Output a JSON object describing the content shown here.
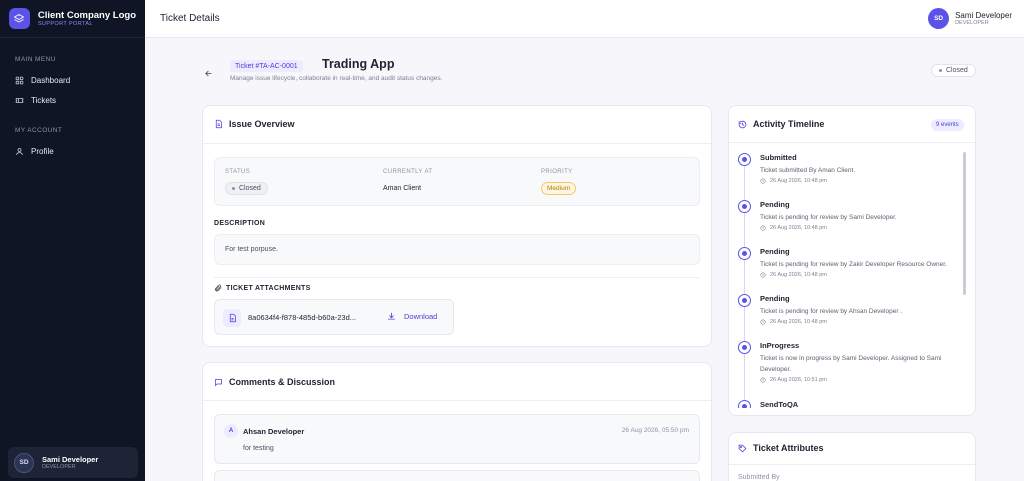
{
  "brand": {
    "title": "Client Company Logo",
    "subtitle": "SUPPORT PORTAL"
  },
  "sidebar": {
    "main_menu_label": "MAIN MENU",
    "main_items": [
      {
        "label": "Dashboard",
        "icon": "grid-icon"
      },
      {
        "label": "Tickets",
        "icon": "ticket-icon"
      }
    ],
    "account_label": "MY ACCOUNT",
    "account_items": [
      {
        "label": "Profile",
        "icon": "user-icon"
      }
    ],
    "user": {
      "initials": "SD",
      "name": "Sami Developer",
      "role": "DEVELOPER"
    }
  },
  "header": {
    "title": "Ticket Details",
    "user": {
      "initials": "SD",
      "name": "Sami Developer",
      "role": "DEVELOPER"
    }
  },
  "ticket": {
    "id": "Ticket #TA-AC-0001",
    "title": "Trading App",
    "subtitle": "Manage issue lifecycle, collaborate in real-time, and audit status changes.",
    "status": "Closed"
  },
  "overview": {
    "title": "Issue Overview",
    "status_label": "STATUS",
    "status_value": "Closed",
    "currently_at_label": "CURRENTLY AT",
    "currently_at_value": "Aman Client",
    "priority_label": "PRIORITY",
    "priority_value": "Medium",
    "description_label": "DESCRIPTION",
    "description": "For test porpuse.",
    "attachments_label": "TICKET ATTACHMENTS",
    "attachment": {
      "file_name": "8a0634f4-f878-485d-b60a-23d...",
      "download_label": "Download"
    }
  },
  "comments": {
    "title": "Comments & Discussion",
    "items": [
      {
        "initial": "A",
        "author": "Ahsan Developer",
        "time": "26 Aug 2026, 05:50 pm",
        "text": "for testing"
      }
    ]
  },
  "timeline": {
    "title": "Activity Timeline",
    "badge": "9 events",
    "events": [
      {
        "status": "Submitted",
        "message": "Ticket submitted By Aman Client.",
        "time": "26 Aug 2026, 10:48 pm"
      },
      {
        "status": "Pending",
        "message": "Ticket is pending for review by Sami Developer.",
        "time": "26 Aug 2026, 10:48 pm"
      },
      {
        "status": "Pending",
        "message": "Ticket is pending for review by Zakir Developer Resource Owner.",
        "time": "26 Aug 2026, 10:48 pm"
      },
      {
        "status": "Pending",
        "message": "Ticket is pending for review by Ahsan Developer .",
        "time": "26 Aug 2026, 10:48 pm"
      },
      {
        "status": "InProgress",
        "message": "Ticket is now in progress by Sami Developer. Assigned to Sami Developer.",
        "time": "26 Aug 2026, 10:51 pm"
      },
      {
        "status": "SendToQA",
        "message": "",
        "time": ""
      }
    ]
  },
  "attributes": {
    "title": "Ticket Attributes",
    "submitted_by_label": "Submitted By"
  },
  "colors": {
    "accent": "#5b52e8",
    "sidebar_bg": "#0f1525",
    "page_bg": "#f6f6fb",
    "medium": "#b57b07"
  }
}
